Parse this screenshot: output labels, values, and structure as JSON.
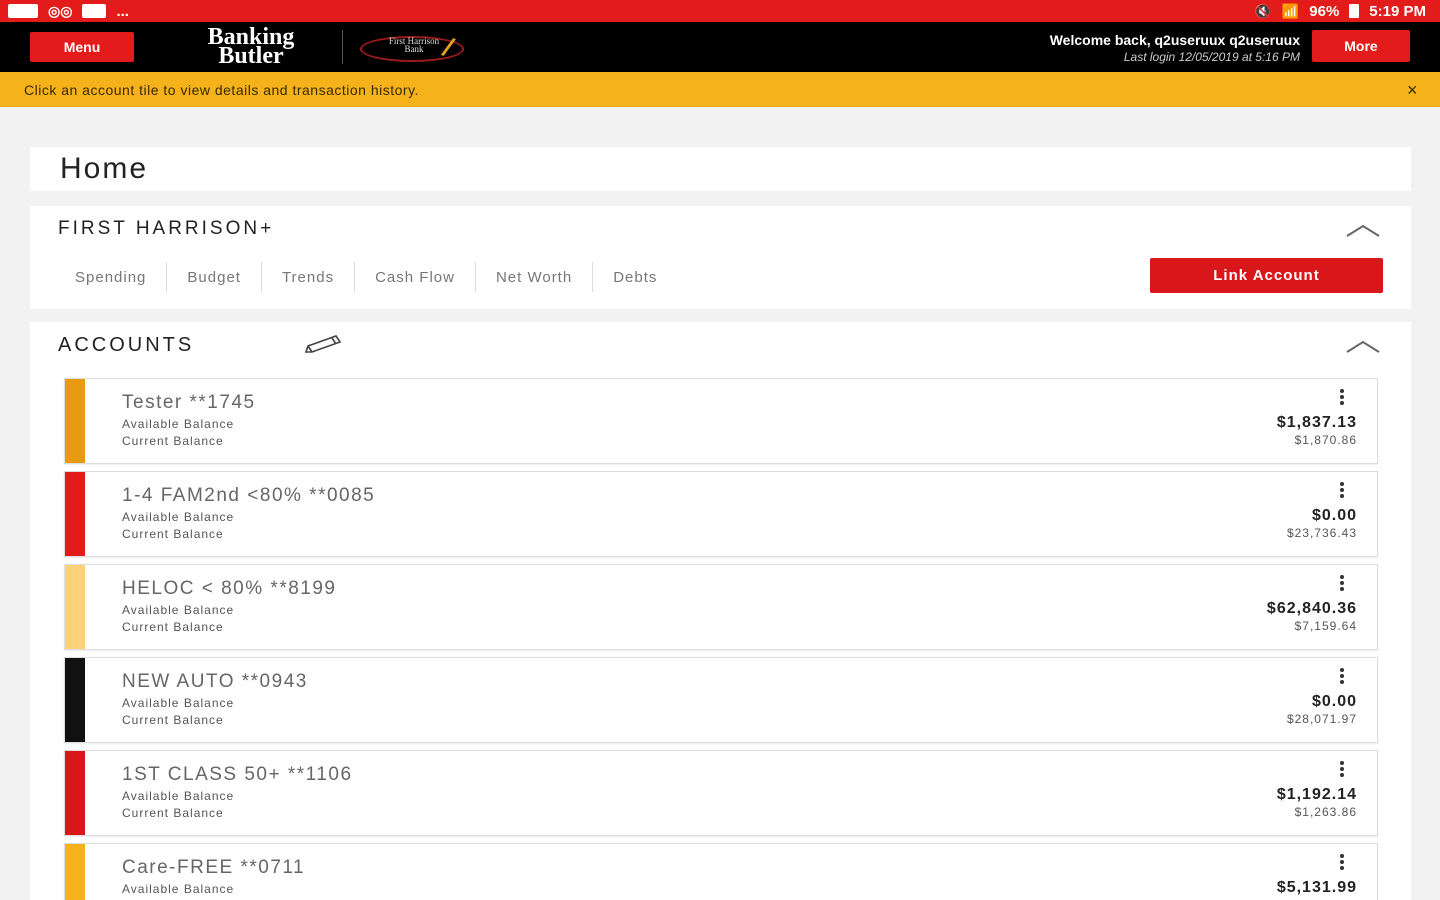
{
  "statusbar": {
    "dots": "...",
    "right_text": "96% ▮ 5:19 PM",
    "battery": "96%",
    "time": "5:19 PM"
  },
  "header": {
    "menu_label": "Menu",
    "logo_line1": "Banking",
    "logo_line2": "Butler",
    "bank_logo_text": "First Harrison Bank",
    "welcome": "Welcome back, q2useruux q2useruux",
    "last_login": "Last login 12/05/2019 at 5:16 PM",
    "more_label": "More"
  },
  "notice": {
    "text": "Click an account tile to view details and transaction history.",
    "close": "×"
  },
  "page": {
    "title": "Home"
  },
  "first_harrison": {
    "title": "FIRST HARRISON+",
    "tabs": [
      {
        "label": "Spending"
      },
      {
        "label": "Budget"
      },
      {
        "label": "Trends"
      },
      {
        "label": "Cash Flow"
      },
      {
        "label": "Net Worth"
      },
      {
        "label": "Debts"
      }
    ],
    "link_account": "Link Account"
  },
  "accounts": {
    "title": "ACCOUNTS",
    "available_label": "Available Balance",
    "current_label": "Current Balance",
    "items": [
      {
        "name": "Tester **1745",
        "available": "$1,837.13",
        "current": "$1,870.86",
        "color": "#e89a12"
      },
      {
        "name": "1-4 FAM2nd <80% **0085",
        "available": "$0.00",
        "current": "$23,736.43",
        "color": "#e31b1b"
      },
      {
        "name": "HELOC < 80% **8199",
        "available": "$62,840.36",
        "current": "$7,159.64",
        "color": "#fbd17a"
      },
      {
        "name": "NEW AUTO **0943",
        "available": "$0.00",
        "current": "$28,071.97",
        "color": "#111111"
      },
      {
        "name": "1ST CLASS 50+ **1106",
        "available": "$1,192.14",
        "current": "$1,263.86",
        "color": "#d9171b"
      },
      {
        "name": "Care-FREE **0711",
        "available": "$5,131.99",
        "current": "",
        "color": "#f5b21b"
      }
    ]
  },
  "colors": {
    "brand_red": "#e31b1b",
    "notice_yellow": "#f5b21b",
    "header_black": "#000000"
  }
}
